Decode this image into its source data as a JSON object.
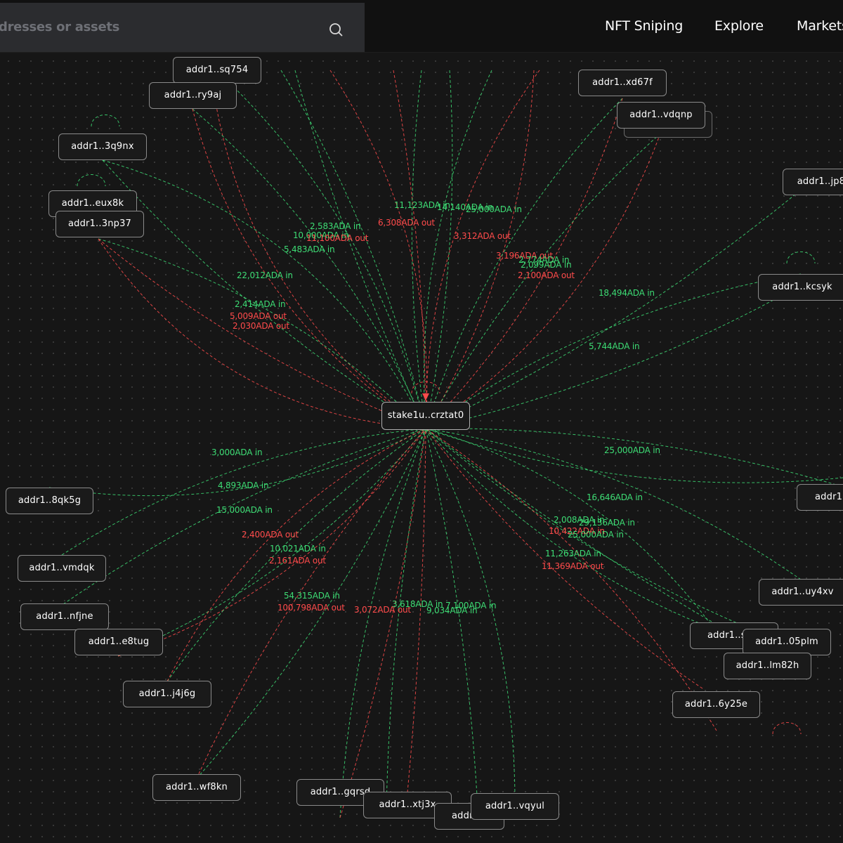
{
  "search": {
    "placeholder": "dresses or assets"
  },
  "nav": [
    {
      "label": "NFT Sniping"
    },
    {
      "label": "Explore"
    },
    {
      "label": "Markets"
    }
  ],
  "graph": {
    "center": {
      "label": "stake1u..crztat0"
    },
    "nodes": [
      {
        "label": "addr1..sq754"
      },
      {
        "label": "addr1..ry9aj"
      },
      {
        "label": "addr1..3q9nx"
      },
      {
        "label": "addr1..eux8k"
      },
      {
        "label": "addr1..3np37"
      },
      {
        "label": "addr1..xd67f"
      },
      {
        "label": "addr1..vdqnp"
      },
      {
        "label": "addr1..jp8"
      },
      {
        "label": "addr1..kcsyk"
      },
      {
        "label": "addr1..8qk5g"
      },
      {
        "label": "addr1..vmdqk"
      },
      {
        "label": "addr1..nfjne"
      },
      {
        "label": "addr1..e8tug"
      },
      {
        "label": "addr1..j4j6g"
      },
      {
        "label": "addr1..wf8kn"
      },
      {
        "label": "addr1..gqrsd"
      },
      {
        "label": "addr1..xtj3x"
      },
      {
        "label": "addr1..u"
      },
      {
        "label": "addr1..vqyul"
      },
      {
        "label": "addr1.."
      },
      {
        "label": "addr1..uy4xv"
      },
      {
        "label": "addr1..s"
      },
      {
        "label": "addr1..05plm"
      },
      {
        "label": "addr1..lm82h"
      },
      {
        "label": "addr1..6y25e"
      }
    ],
    "edge_labels": [
      {
        "text": "11,123ADA in",
        "dir": "in"
      },
      {
        "text": "14,140ADA in",
        "dir": "in"
      },
      {
        "text": "25,000ADA in",
        "dir": "in"
      },
      {
        "text": "6,308ADA out",
        "dir": "out"
      },
      {
        "text": "2,583ADA in",
        "dir": "in"
      },
      {
        "text": "10,000ADA in",
        "dir": "in"
      },
      {
        "text": "11,100ADA out",
        "dir": "out"
      },
      {
        "text": "5,483ADA in",
        "dir": "in"
      },
      {
        "text": "3,312ADA out",
        "dir": "out"
      },
      {
        "text": "3,196ADA out",
        "dir": "out"
      },
      {
        "text": "2,774ADA in",
        "dir": "in"
      },
      {
        "text": "2,099ADA in",
        "dir": "in"
      },
      {
        "text": "2,100ADA out",
        "dir": "out"
      },
      {
        "text": "22,012ADA in",
        "dir": "in"
      },
      {
        "text": "18,494ADA in",
        "dir": "in"
      },
      {
        "text": "2,414ADA in",
        "dir": "in"
      },
      {
        "text": "5,009ADA out",
        "dir": "out"
      },
      {
        "text": "2,030ADA out",
        "dir": "out"
      },
      {
        "text": "5,744ADA in",
        "dir": "in"
      },
      {
        "text": "3,000ADA in",
        "dir": "in"
      },
      {
        "text": "25,000ADA in",
        "dir": "in"
      },
      {
        "text": "4,893ADA in",
        "dir": "in"
      },
      {
        "text": "16,646ADA in",
        "dir": "in"
      },
      {
        "text": "15,000ADA in",
        "dir": "in"
      },
      {
        "text": "2,008ADA in",
        "dir": "in"
      },
      {
        "text": "29,136ADA in",
        "dir": "in"
      },
      {
        "text": "10,422ADA in",
        "dir": "out"
      },
      {
        "text": "25,000ADA in",
        "dir": "in"
      },
      {
        "text": "2,400ADA out",
        "dir": "out"
      },
      {
        "text": "10,021ADA in",
        "dir": "in"
      },
      {
        "text": "2,161ADA out",
        "dir": "out"
      },
      {
        "text": "11,263ADA in",
        "dir": "in"
      },
      {
        "text": "11,369ADA out",
        "dir": "out"
      },
      {
        "text": "54,315ADA in",
        "dir": "in"
      },
      {
        "text": "100,798ADA out",
        "dir": "out"
      },
      {
        "text": "3,072ADA out",
        "dir": "out"
      },
      {
        "text": "3,618ADA in",
        "dir": "in"
      },
      {
        "text": "7,100ADA in",
        "dir": "in"
      },
      {
        "text": "9,034ADA in",
        "dir": "in"
      }
    ]
  },
  "colors": {
    "in": "#3ddc74",
    "out": "#ff4b4b",
    "background": "#161616",
    "node_border": "#8a8a8a"
  }
}
